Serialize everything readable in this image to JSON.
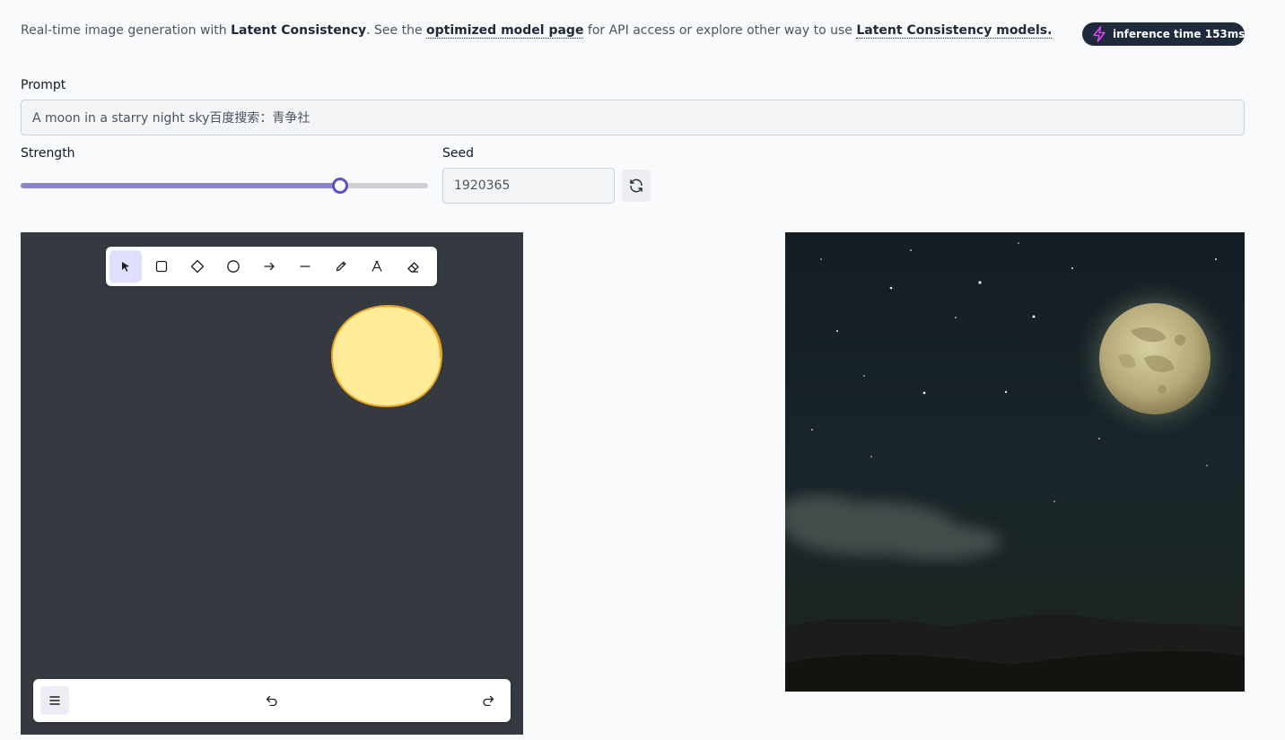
{
  "intro": {
    "part1": "Real-time image generation with ",
    "latent_consistency": "Latent Consistency",
    "part2": ". See the ",
    "optimized_model_link": "optimized model page",
    "part3": " for API access or explore other way to use ",
    "lcm_models_link": "Latent Consistency models."
  },
  "badge": {
    "label": "inference time 153ms",
    "icon": "lightning-bolt-icon",
    "icon_color": "#d946ef"
  },
  "prompt": {
    "label": "Prompt",
    "value": "A moon in a starry night sky百度搜索：青争社"
  },
  "strength": {
    "label": "Strength",
    "value": 0.785
  },
  "seed": {
    "label": "Seed",
    "value": "1920365",
    "refresh_icon": "refresh-icon"
  },
  "toolbar": {
    "tools": [
      "selection",
      "rectangle",
      "diamond",
      "ellipse",
      "arrow",
      "line",
      "draw",
      "text",
      "eraser"
    ],
    "active_tool": "selection"
  },
  "colors": {
    "canvas_bg": "#343a40",
    "slider_fill": "#8b84c9",
    "slider_thumb": "#5b50c4",
    "sun_fill": "#ffec99",
    "sun_stroke": "#e8a425"
  }
}
